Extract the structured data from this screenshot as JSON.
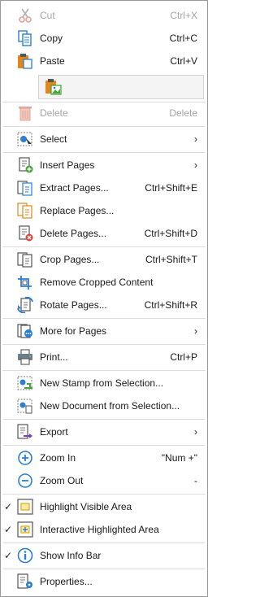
{
  "menu": {
    "cut": {
      "label": "Cut",
      "shortcut": "Ctrl+X"
    },
    "copy": {
      "label": "Copy",
      "shortcut": "Ctrl+C"
    },
    "paste": {
      "label": "Paste",
      "shortcut": "Ctrl+V"
    },
    "delete": {
      "label": "Delete",
      "shortcut": "Delete"
    },
    "select": {
      "label": "Select"
    },
    "insert_pages": {
      "label": "Insert Pages"
    },
    "extract_pages": {
      "label": "Extract Pages...",
      "shortcut": "Ctrl+Shift+E"
    },
    "replace_pages": {
      "label": "Replace Pages..."
    },
    "delete_pages": {
      "label": "Delete Pages...",
      "shortcut": "Ctrl+Shift+D"
    },
    "crop_pages": {
      "label": "Crop Pages...",
      "shortcut": "Ctrl+Shift+T"
    },
    "remove_cropped": {
      "label": "Remove Cropped Content"
    },
    "rotate_pages": {
      "label": "Rotate Pages...",
      "shortcut": "Ctrl+Shift+R"
    },
    "more_for_pages": {
      "label": "More for Pages"
    },
    "print": {
      "label": "Print...",
      "shortcut": "Ctrl+P"
    },
    "new_stamp": {
      "label": "New Stamp from Selection..."
    },
    "new_document": {
      "label": "New Document from Selection..."
    },
    "export": {
      "label": "Export"
    },
    "zoom_in": {
      "label": "Zoom In",
      "shortcut": "\"Num +\""
    },
    "zoom_out": {
      "label": "Zoom Out",
      "shortcut": "-"
    },
    "highlight_visible": {
      "label": "Highlight Visible Area",
      "checked": true
    },
    "interactive_highlight": {
      "label": "Interactive Highlighted Area",
      "checked": true
    },
    "show_info_bar": {
      "label": "Show Info Bar",
      "checked": true
    },
    "properties": {
      "label": "Properties..."
    },
    "submenu_arrow": "›",
    "check_mark": "✓"
  },
  "colors": {
    "accent_blue": "#2a7fd4",
    "orange": "#e0861a",
    "red": "#d9443a",
    "green": "#4aa33d",
    "disabled": "#a5a5a5"
  }
}
